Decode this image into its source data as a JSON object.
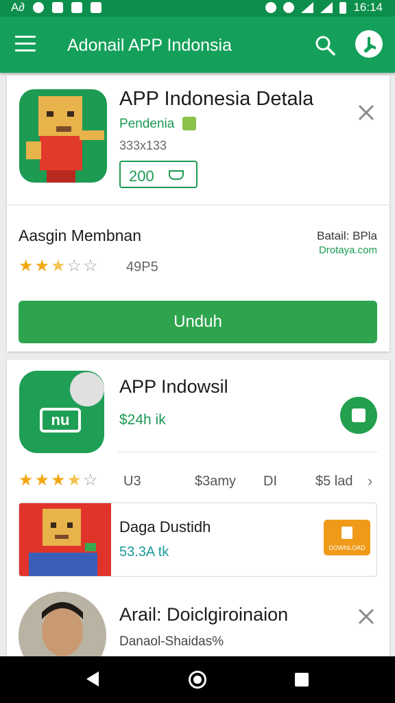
{
  "status_bar": {
    "left_text": "A∂",
    "time": "16:14"
  },
  "app_bar": {
    "title": "Adonail APP Indonsia"
  },
  "card1": {
    "title": "APP Indonesia Detala",
    "developer": "Pendenia",
    "dimensions": "333x133",
    "price": "200",
    "subtitle": "Aasgin Membnan",
    "side_line1": "Batail: BPla",
    "side_line2": "Drotaya.com",
    "rating": 2.5,
    "rating_count": "49P5",
    "install_label": "Unduh"
  },
  "card2": {
    "title": "APP Indowsil",
    "icon_text": "nu",
    "price": "$24h ik",
    "rating": 3.5,
    "meta": [
      "U3",
      "$3amy",
      "DI",
      "$5 lad"
    ],
    "inner": {
      "title": "Daga Dustidh",
      "subtitle": "53.3A tk",
      "button_label": "DOWNLOAD"
    },
    "person": {
      "title": "Arail: Doiclgiroinaion",
      "subtitle": "Danaol-Shaidas%"
    }
  },
  "colors": {
    "primary": "#14a05a",
    "status": "#0c8f4c",
    "install": "#2fa44f",
    "star": "#f3a712",
    "orange": "#f09a19"
  }
}
